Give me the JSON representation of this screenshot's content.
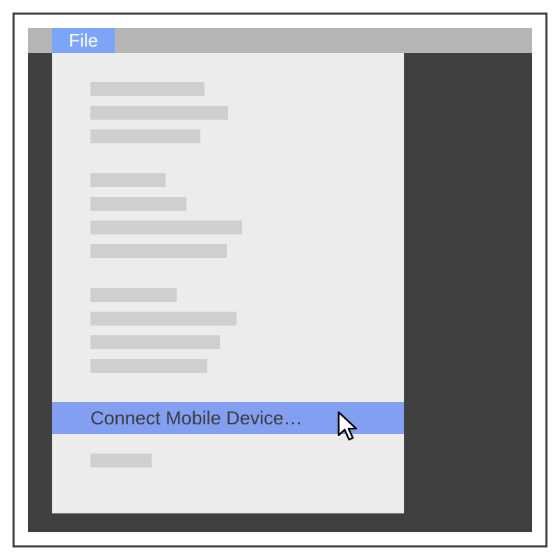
{
  "menubar": {
    "file_label": "File"
  },
  "dropdown": {
    "highlighted_item_label": "Connect Mobile Device…"
  },
  "colors": {
    "accent": "#7ca4f7",
    "highlight": "#829ff2",
    "panel": "#ececec",
    "placeholder": "#cfcfcf",
    "dark_bg": "#404040",
    "menubar_bg": "#b5b5b5"
  }
}
